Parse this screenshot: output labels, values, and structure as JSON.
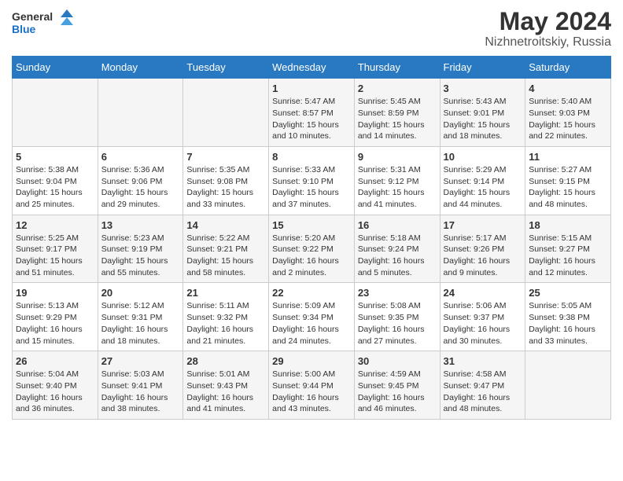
{
  "header": {
    "logo_line1": "General",
    "logo_line2": "Blue",
    "main_title": "May 2024",
    "subtitle": "Nizhnetroitskiy, Russia"
  },
  "days_of_week": [
    "Sunday",
    "Monday",
    "Tuesday",
    "Wednesday",
    "Thursday",
    "Friday",
    "Saturday"
  ],
  "weeks": [
    [
      {
        "num": "",
        "info": ""
      },
      {
        "num": "",
        "info": ""
      },
      {
        "num": "",
        "info": ""
      },
      {
        "num": "1",
        "info": "Sunrise: 5:47 AM\nSunset: 8:57 PM\nDaylight: 15 hours and 10 minutes."
      },
      {
        "num": "2",
        "info": "Sunrise: 5:45 AM\nSunset: 8:59 PM\nDaylight: 15 hours and 14 minutes."
      },
      {
        "num": "3",
        "info": "Sunrise: 5:43 AM\nSunset: 9:01 PM\nDaylight: 15 hours and 18 minutes."
      },
      {
        "num": "4",
        "info": "Sunrise: 5:40 AM\nSunset: 9:03 PM\nDaylight: 15 hours and 22 minutes."
      }
    ],
    [
      {
        "num": "5",
        "info": "Sunrise: 5:38 AM\nSunset: 9:04 PM\nDaylight: 15 hours and 25 minutes."
      },
      {
        "num": "6",
        "info": "Sunrise: 5:36 AM\nSunset: 9:06 PM\nDaylight: 15 hours and 29 minutes."
      },
      {
        "num": "7",
        "info": "Sunrise: 5:35 AM\nSunset: 9:08 PM\nDaylight: 15 hours and 33 minutes."
      },
      {
        "num": "8",
        "info": "Sunrise: 5:33 AM\nSunset: 9:10 PM\nDaylight: 15 hours and 37 minutes."
      },
      {
        "num": "9",
        "info": "Sunrise: 5:31 AM\nSunset: 9:12 PM\nDaylight: 15 hours and 41 minutes."
      },
      {
        "num": "10",
        "info": "Sunrise: 5:29 AM\nSunset: 9:14 PM\nDaylight: 15 hours and 44 minutes."
      },
      {
        "num": "11",
        "info": "Sunrise: 5:27 AM\nSunset: 9:15 PM\nDaylight: 15 hours and 48 minutes."
      }
    ],
    [
      {
        "num": "12",
        "info": "Sunrise: 5:25 AM\nSunset: 9:17 PM\nDaylight: 15 hours and 51 minutes."
      },
      {
        "num": "13",
        "info": "Sunrise: 5:23 AM\nSunset: 9:19 PM\nDaylight: 15 hours and 55 minutes."
      },
      {
        "num": "14",
        "info": "Sunrise: 5:22 AM\nSunset: 9:21 PM\nDaylight: 15 hours and 58 minutes."
      },
      {
        "num": "15",
        "info": "Sunrise: 5:20 AM\nSunset: 9:22 PM\nDaylight: 16 hours and 2 minutes."
      },
      {
        "num": "16",
        "info": "Sunrise: 5:18 AM\nSunset: 9:24 PM\nDaylight: 16 hours and 5 minutes."
      },
      {
        "num": "17",
        "info": "Sunrise: 5:17 AM\nSunset: 9:26 PM\nDaylight: 16 hours and 9 minutes."
      },
      {
        "num": "18",
        "info": "Sunrise: 5:15 AM\nSunset: 9:27 PM\nDaylight: 16 hours and 12 minutes."
      }
    ],
    [
      {
        "num": "19",
        "info": "Sunrise: 5:13 AM\nSunset: 9:29 PM\nDaylight: 16 hours and 15 minutes."
      },
      {
        "num": "20",
        "info": "Sunrise: 5:12 AM\nSunset: 9:31 PM\nDaylight: 16 hours and 18 minutes."
      },
      {
        "num": "21",
        "info": "Sunrise: 5:11 AM\nSunset: 9:32 PM\nDaylight: 16 hours and 21 minutes."
      },
      {
        "num": "22",
        "info": "Sunrise: 5:09 AM\nSunset: 9:34 PM\nDaylight: 16 hours and 24 minutes."
      },
      {
        "num": "23",
        "info": "Sunrise: 5:08 AM\nSunset: 9:35 PM\nDaylight: 16 hours and 27 minutes."
      },
      {
        "num": "24",
        "info": "Sunrise: 5:06 AM\nSunset: 9:37 PM\nDaylight: 16 hours and 30 minutes."
      },
      {
        "num": "25",
        "info": "Sunrise: 5:05 AM\nSunset: 9:38 PM\nDaylight: 16 hours and 33 minutes."
      }
    ],
    [
      {
        "num": "26",
        "info": "Sunrise: 5:04 AM\nSunset: 9:40 PM\nDaylight: 16 hours and 36 minutes."
      },
      {
        "num": "27",
        "info": "Sunrise: 5:03 AM\nSunset: 9:41 PM\nDaylight: 16 hours and 38 minutes."
      },
      {
        "num": "28",
        "info": "Sunrise: 5:01 AM\nSunset: 9:43 PM\nDaylight: 16 hours and 41 minutes."
      },
      {
        "num": "29",
        "info": "Sunrise: 5:00 AM\nSunset: 9:44 PM\nDaylight: 16 hours and 43 minutes."
      },
      {
        "num": "30",
        "info": "Sunrise: 4:59 AM\nSunset: 9:45 PM\nDaylight: 16 hours and 46 minutes."
      },
      {
        "num": "31",
        "info": "Sunrise: 4:58 AM\nSunset: 9:47 PM\nDaylight: 16 hours and 48 minutes."
      },
      {
        "num": "",
        "info": ""
      }
    ]
  ]
}
